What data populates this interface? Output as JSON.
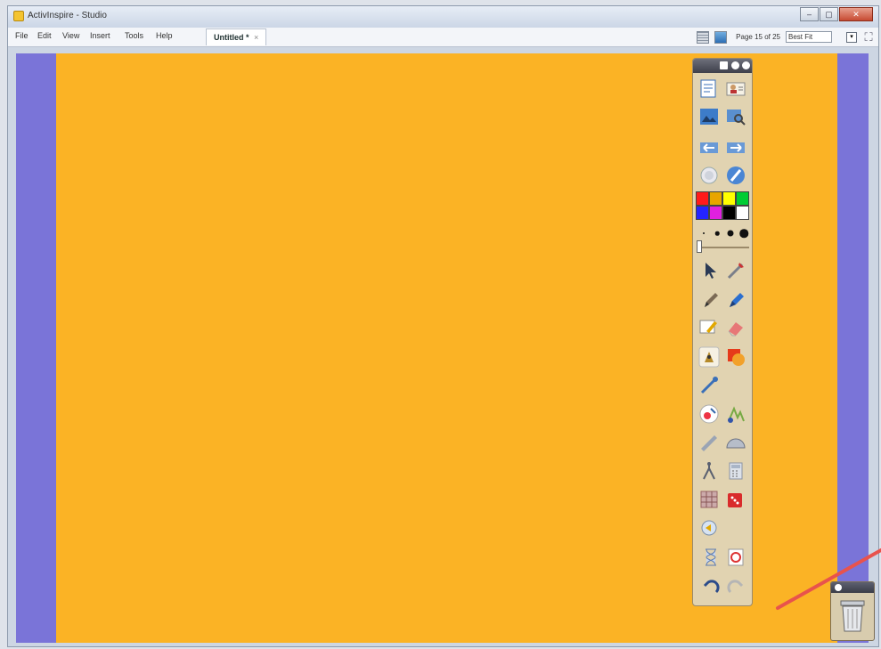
{
  "window": {
    "title": "ActivInspire - Studio",
    "controls": {
      "minimize": "–",
      "maximize": "▢",
      "close": "✕"
    }
  },
  "menu": {
    "items": [
      "File",
      "Edit",
      "View",
      "Insert",
      "Tools",
      "Help"
    ],
    "tab": {
      "label": "Untitled *",
      "close": "×"
    }
  },
  "toolbar": {
    "page_indicator": "Page 15 of 25",
    "fit_option": "Best Fit",
    "dropdown_glyph": "▾",
    "fullscreen_glyph": "⛶"
  },
  "toolbox": {
    "palette": [
      "#ff1a1a",
      "#e9a400",
      "#ffff00",
      "#00cc33",
      "#2424ff",
      "#e020e0",
      "#000000",
      "#ffffff"
    ],
    "selected_color": 1,
    "pen_sizes": 4
  },
  "colors": {
    "page": "#fbb325",
    "workspace": "#7a74d8",
    "toolbox": "#e1d3b1",
    "annotation": "#e8534c"
  }
}
